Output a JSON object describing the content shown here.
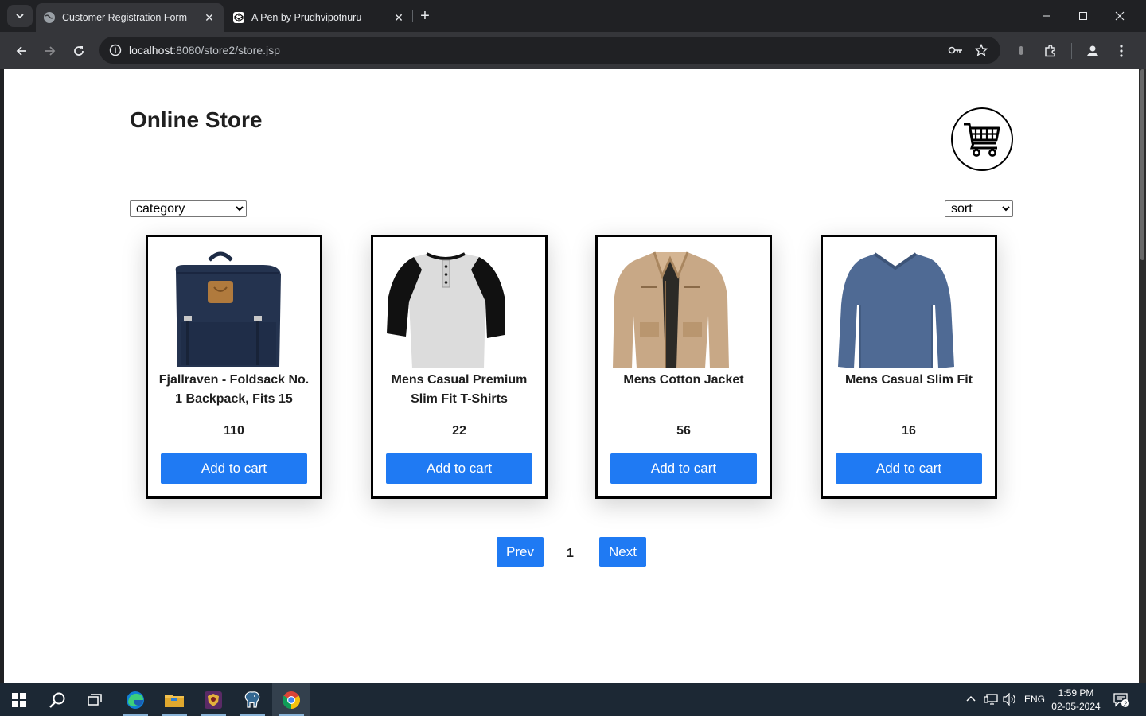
{
  "browser": {
    "tabs": [
      {
        "title": "Customer Registration Form",
        "active": true
      },
      {
        "title": "A Pen by Prudhvipotnuru",
        "active": false
      }
    ],
    "url_host": "localhost",
    "url_rest": ":8080/store2/store.jsp"
  },
  "page": {
    "title": "Online Store",
    "category_select": {
      "selected": "category"
    },
    "sort_select": {
      "selected": "sort"
    }
  },
  "products": [
    {
      "name": "Fjallraven - Foldsack No. 1 Backpack, Fits 15",
      "price": "110",
      "button": "Add to cart",
      "image": "backpack"
    },
    {
      "name": "Mens Casual Premium Slim Fit T-Shirts",
      "price": "22",
      "button": "Add to cart",
      "image": "raglan-tshirt"
    },
    {
      "name": "Mens Cotton Jacket",
      "price": "56",
      "button": "Add to cart",
      "image": "jacket"
    },
    {
      "name": "Mens Casual Slim Fit",
      "price": "16",
      "button": "Add to cart",
      "image": "long-sleeve-shirt"
    }
  ],
  "pagination": {
    "prev": "Prev",
    "current": "1",
    "next": "Next"
  },
  "taskbar": {
    "language": "ENG",
    "time": "1:59 PM",
    "date": "02-05-2024",
    "notifications": "2"
  },
  "colors": {
    "accent": "#1f7af3",
    "chrome_dark": "#202124",
    "chrome_toolbar": "#35363a"
  }
}
